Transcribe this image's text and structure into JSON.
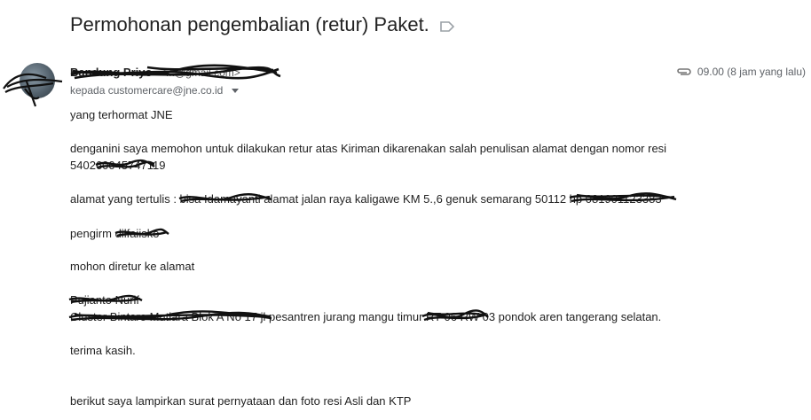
{
  "subject": "Permohonan pengembalian (retur) Paket.",
  "sender": {
    "name": "Bandung Priyo",
    "email": "<...@gmail.com>"
  },
  "recipient": {
    "prefix": "kepada",
    "address": "customercare@jne.co.id"
  },
  "time": "09.00 (8 jam yang lalu)",
  "body": {
    "greeting": "yang terhormat JNE",
    "para1_line1": "denganini saya memohon untuk dilakukan retur atas Kiriman dikarenakan salah penulisan alamat  dengan nomor resi",
    "para1_line2": "540260045747119",
    "address_written": "alamat yang tertulis : bisa Idamayanti alamat jalan raya kaligawe KM 5.,6 genuk semarang 50112 hp 081901123383",
    "sender_line": "pengirm dilfaiisko",
    "return_intro": "mohon diretur ke alamat",
    "return_name": "Pujianto Nurif",
    "return_address": "Cluster Bintaro Mutiara Blok A No 17 jl pesantren jurang mangu timur RT 06 RW 03 pondok aren tangerang selatan.",
    "thanks": "terima kasih.",
    "attachment_note": "berikut saya lampirkan surat pernyataan dan foto resi Asli dan KTP"
  },
  "icons": {
    "label": "label-tag-icon",
    "attachment": "paperclip-icon",
    "dropdown": "chevron-down-icon"
  }
}
